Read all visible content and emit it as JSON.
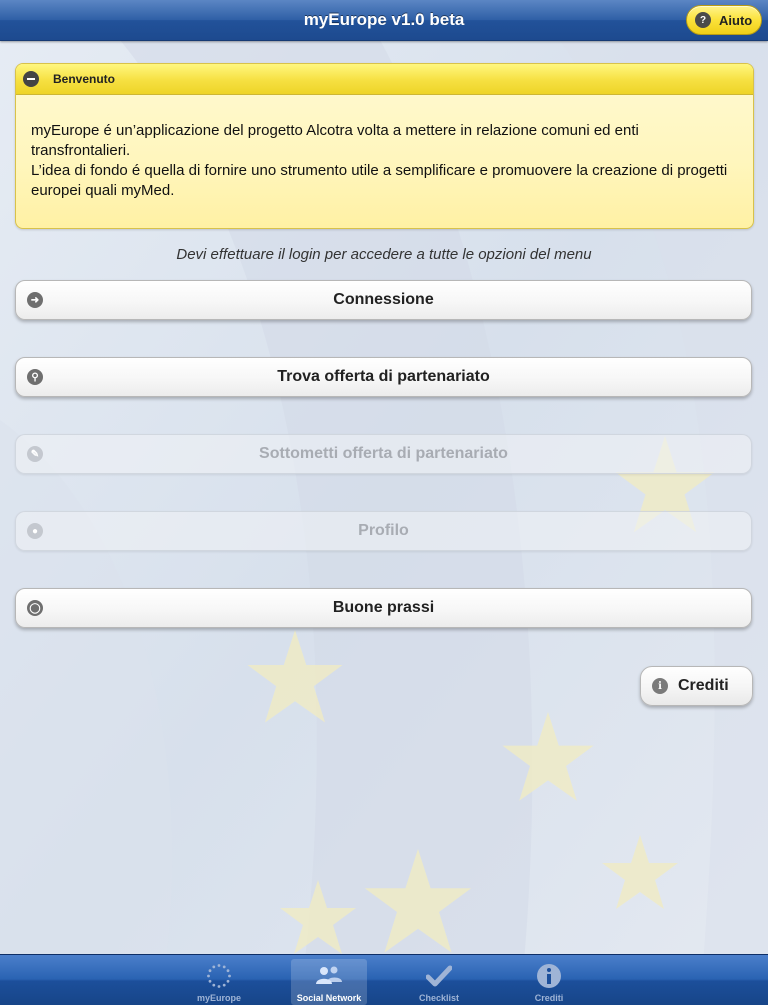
{
  "header": {
    "title": "myEurope v1.0 beta",
    "help_label": "Aiuto"
  },
  "welcome": {
    "heading": "Benvenuto",
    "paragraph1": "myEurope é un’applicazione del progetto Alcotra volta a mettere in relazione comuni ed enti transfrontalieri.",
    "paragraph2": "L’idea di fondo é quella di fornire uno strumento utile a semplificare e promuovere la creazione di progetti europei quali myMed."
  },
  "login_hint": "Devi effettuare il login per accedere a tutte le opzioni del menu",
  "menu": [
    {
      "label": "Connessione",
      "icon": "login-arrow-icon",
      "enabled": true
    },
    {
      "label": "Trova offerta di partenariato",
      "icon": "search-icon",
      "enabled": true
    },
    {
      "label": "Sottometti offerta di partenariato",
      "icon": "pencil-icon",
      "enabled": false
    },
    {
      "label": "Profilo",
      "icon": "user-icon",
      "enabled": false
    },
    {
      "label": "Buone prassi",
      "icon": "speech-bubble-icon",
      "enabled": true
    }
  ],
  "credits_label": "Crediti",
  "tabs": [
    {
      "label": "myEurope",
      "icon": "eu-stars-icon",
      "active": false
    },
    {
      "label": "Social Network",
      "icon": "people-icon",
      "active": true
    },
    {
      "label": "Checklist",
      "icon": "checkmark-icon",
      "active": false
    },
    {
      "label": "Crediti",
      "icon": "info-icon",
      "active": false
    }
  ],
  "colors": {
    "header_blue": "#2f5fa6",
    "help_yellow": "#fbe23a",
    "panel_yellow": "#fff6bd",
    "tabbar_blue": "#1c4f9b"
  }
}
